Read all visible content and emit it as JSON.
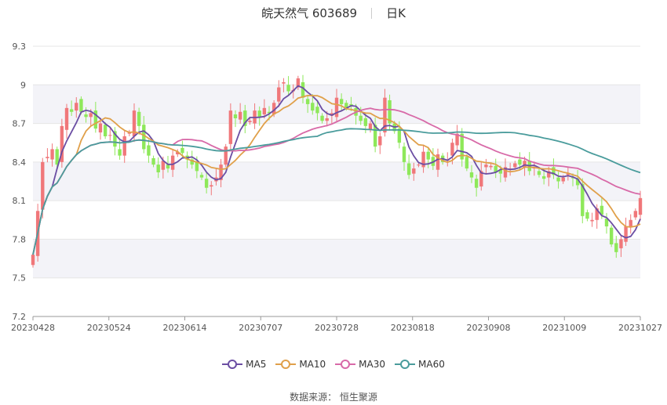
{
  "header": {
    "name": "皖天然气 603689",
    "period": "日K"
  },
  "source": "数据来源：  恒生聚源",
  "colors": {
    "up": "#f0777a",
    "down": "#8ee85a",
    "ma5": "#6b4ea3",
    "ma10": "#e0a04a",
    "ma30": "#d86aa8",
    "ma60": "#4a9c9c",
    "band": "#f3f3f8"
  },
  "chart_data": {
    "type": "candlestick",
    "y_ticks": [
      "7.2",
      "7.5",
      "7.8",
      "8.1",
      "8.4",
      "8.7",
      "9",
      "9.3"
    ],
    "x_ticks": [
      "20230428",
      "20230524",
      "20230614",
      "20230707",
      "20230728",
      "20230818",
      "20230908",
      "20231009",
      "20231027"
    ],
    "ylim": [
      7.2,
      9.3
    ],
    "legend": [
      "MA5",
      "MA10",
      "MA30",
      "MA60"
    ],
    "closes": [
      7.68,
      8.02,
      8.4,
      8.44,
      8.5,
      8.38,
      8.68,
      8.82,
      8.79,
      8.86,
      8.79,
      8.75,
      8.78,
      8.66,
      8.7,
      8.6,
      8.61,
      8.52,
      8.45,
      8.6,
      8.63,
      8.8,
      8.68,
      8.5,
      8.45,
      8.38,
      8.32,
      8.41,
      8.35,
      8.45,
      8.48,
      8.47,
      8.42,
      8.38,
      8.33,
      8.28,
      8.2,
      8.22,
      8.28,
      8.38,
      8.52,
      8.8,
      8.74,
      8.79,
      8.68,
      8.72,
      8.8,
      8.75,
      8.82,
      8.78,
      8.86,
      8.98,
      9.02,
      8.95,
      8.96,
      9.05,
      8.9,
      8.85,
      8.8,
      8.78,
      8.72,
      8.74,
      8.78,
      8.9,
      8.85,
      8.82,
      8.84,
      8.76,
      8.72,
      8.68,
      8.7,
      8.52,
      8.6,
      8.9,
      8.7,
      8.64,
      8.55,
      8.4,
      8.3,
      8.35,
      8.38,
      8.48,
      8.42,
      8.37,
      8.46,
      8.4,
      8.42,
      8.55,
      8.62,
      8.42,
      8.35,
      8.28,
      8.2,
      8.33,
      8.38,
      8.37,
      8.32,
      8.31,
      8.36,
      8.35,
      8.39,
      8.38,
      8.41,
      8.33,
      8.36,
      8.3,
      8.27,
      8.33,
      8.3,
      8.25,
      8.28,
      8.31,
      8.28,
      8.22,
      7.98,
      7.96,
      7.95,
      8.04,
      7.99,
      7.9,
      7.76,
      7.7,
      7.8,
      7.9,
      7.95,
      8.02,
      8.12
    ]
  }
}
